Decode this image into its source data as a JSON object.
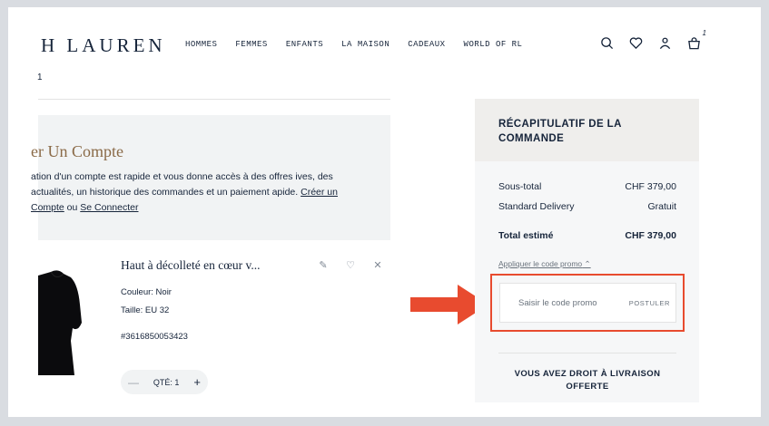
{
  "header": {
    "logo": "H LAUREN",
    "nav": [
      "HOMMES",
      "FEMMES",
      "ENFANTS",
      "LA MAISON",
      "CADEAUX",
      "WORLD OF RL"
    ],
    "bag_count": "1",
    "breadcrumb": "1"
  },
  "account": {
    "title": "er Un Compte",
    "text_before": "ation d'un compte est rapide et vous donne accès à des offres ives, des actualités, un historique des commandes et un paiement apide. ",
    "create_link": "Créer un Compte",
    "or_text": " ou ",
    "login_link": "Se Connecter"
  },
  "product": {
    "name": "Haut à décolleté en cœur v...",
    "color": "Couleur: Noir",
    "size": "Taille: EU 32",
    "sku": "#3616850053423",
    "qty_label": "QTÉ: 1"
  },
  "summary": {
    "title": "RÉCAPITULATIF DE LA COMMANDE",
    "subtotal_label": "Sous-total",
    "subtotal_value": "CHF 379,00",
    "delivery_label": "Standard Delivery",
    "delivery_value": "Gratuit",
    "total_label": "Total estimé",
    "total_value": "CHF 379,00",
    "promo_link": "Appliquer le code promo",
    "promo_placeholder": "Saisir le code promo",
    "promo_button": "POSTULER",
    "shipping_msg": "VOUS AVEZ DROIT À LIVRAISON OFFERTE"
  },
  "colors": {
    "highlight": "#e84b2f",
    "accent_title": "#8a6a47",
    "navy": "#16243a"
  }
}
